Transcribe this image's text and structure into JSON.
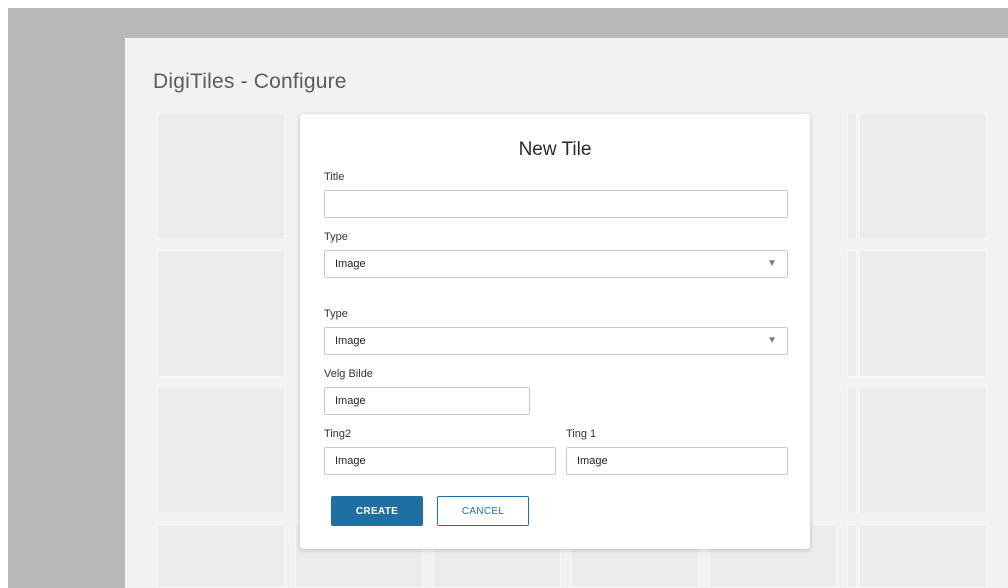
{
  "page": {
    "title": "DigiTiles - Configure"
  },
  "dialog": {
    "title": "New Tile",
    "fields": {
      "title": {
        "label": "Title",
        "value": ""
      },
      "type1": {
        "label": "Type",
        "value": "Image"
      },
      "type2": {
        "label": "Type",
        "value": "Image"
      },
      "velg_bilde": {
        "label": "Velg Bilde",
        "value": "Image"
      },
      "ting2": {
        "label": "Ting2",
        "value": "Image"
      },
      "ting1": {
        "label": "Ting 1",
        "value": "Image"
      }
    },
    "create_label": "CREATE",
    "cancel_label": "CANCEL"
  },
  "icons": {
    "dropdown": "chevron-down-icon"
  },
  "colors": {
    "primary": "#1f6fa3",
    "backdrop": "#b8b8b8",
    "page_background": "#f2f2f2",
    "tile": "#ececec"
  }
}
